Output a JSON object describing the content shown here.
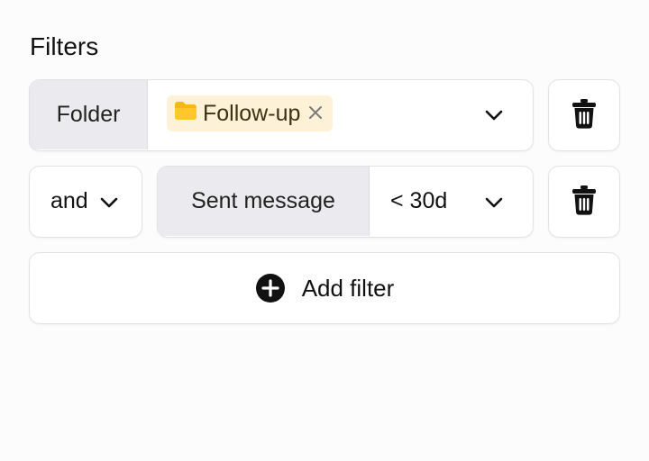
{
  "filters": {
    "title": "Filters",
    "rows": [
      {
        "field": "Folder",
        "tag": {
          "label": "Follow-up",
          "icon": "folder-icon",
          "color": "#f6b90f"
        },
        "icons": {
          "remove": "close-icon",
          "dropdown": "chevron-down-icon",
          "delete": "trash-icon"
        }
      },
      {
        "conjunction": "and",
        "field": "Sent message",
        "value": "< 30d",
        "icons": {
          "dropdown": "chevron-down-icon",
          "delete": "trash-icon"
        }
      }
    ],
    "add_filter": {
      "label": "Add filter",
      "icon": "plus-circle-icon"
    }
  },
  "colors": {
    "chip_bg": "#ebeaee",
    "tag_bg": "#fdf2d8",
    "border": "#e2e2e5"
  }
}
